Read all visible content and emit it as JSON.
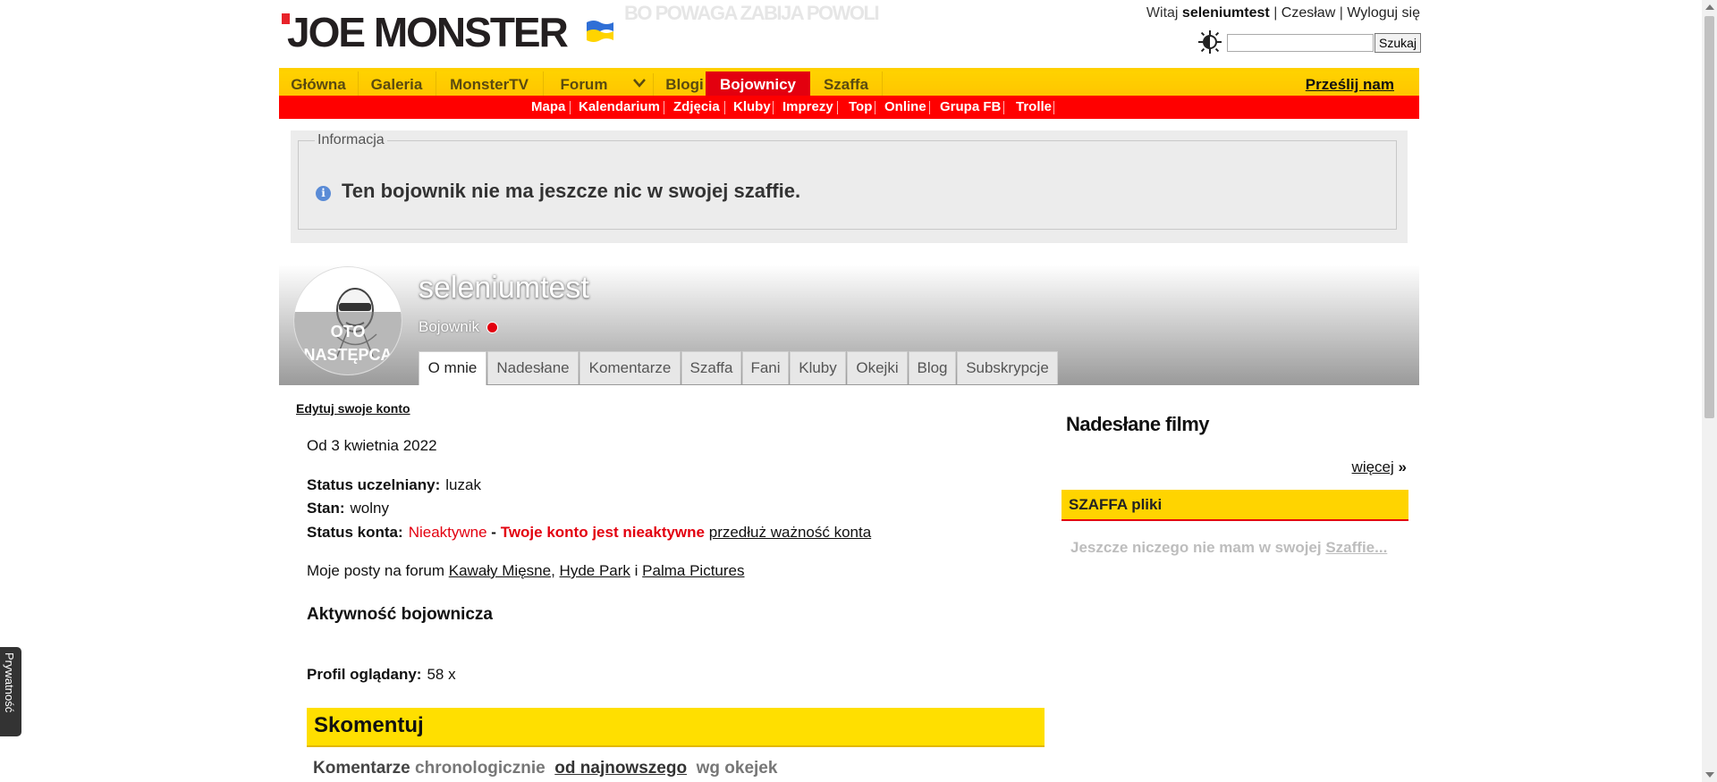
{
  "header": {
    "logo_text": "JOE MONSTER",
    "slogan": "BO POWAGA ZABIJA POWOLI",
    "greeting": "Witaj",
    "username": "seleniumtest",
    "separator": "|",
    "name_link": "Czesław",
    "logout_link": "Wyloguj się",
    "search_button": "Szukaj",
    "search_value": ""
  },
  "nav": {
    "items": [
      "Główna",
      "Galeria",
      "MonsterTV",
      "Forum",
      "Blogi",
      "Bojownicy",
      "Szaffa"
    ],
    "active": "Bojownicy",
    "send_link": "Prześlij nam"
  },
  "subnav": {
    "items": [
      "Mapa",
      "Kalendarium",
      "Zdjęcia",
      "Kluby",
      "Imprezy",
      "Top",
      "Online",
      "Grupa FB",
      "Trolle"
    ]
  },
  "info": {
    "legend": "Informacja",
    "message": "Ten bojownik nie ma jeszcze nic w swojej szaffie."
  },
  "profile": {
    "username": "seleniumtest",
    "rank": "Bojownik",
    "avatar_text": "OTO NASTĘPCA",
    "tabs": [
      "O mnie",
      "Nadesłane",
      "Komentarze",
      "Szaffa",
      "Fani",
      "Kluby",
      "Okejki",
      "Blog",
      "Subskrypcje"
    ],
    "active_tab": "O mnie"
  },
  "about": {
    "edit_link": "Edytuj swoje konto",
    "since": "Od 3 kwietnia 2022",
    "status_label": "Status uczelniany:",
    "status_value": "luzak",
    "state_label": "Stan:",
    "state_value": "wolny",
    "account_label": "Status konta:",
    "account_value": "Nieaktywne",
    "account_dash": "-",
    "account_warning": "Twoje konto jest nieaktywne",
    "extend_link": "przedłuż ważność konta",
    "posts_prefix": "Moje posty na forum",
    "forum_1": "Kawały Mięsne",
    "comma": ",",
    "forum_2": "Hyde Park",
    "and": "i",
    "forum_3": "Palma Pictures",
    "activity_title": "Aktywność bojownicza",
    "views_label": "Profil oglądany:",
    "views_value": "58 x"
  },
  "comments": {
    "title": "Skomentuj",
    "sort_label": "Komentarze",
    "sort_options": [
      "chronologicznie",
      "od najnowszego",
      "wg okejek"
    ],
    "sort_active": "od najnowszego"
  },
  "sidebar": {
    "films_title": "Nadesłane filmy",
    "more_link": "więcej",
    "more_arrow": "»",
    "szaffa_title": "SZAFFA pliki",
    "szaffa_empty_prefix": "Jeszcze niczego nie mam w swojej",
    "szaffa_link": "Szaffie..."
  },
  "privacy_tab": "Prywatność",
  "colors": {
    "yellow": "#ffd200",
    "red": "#e3000f",
    "brand_dark": "#231f20"
  }
}
